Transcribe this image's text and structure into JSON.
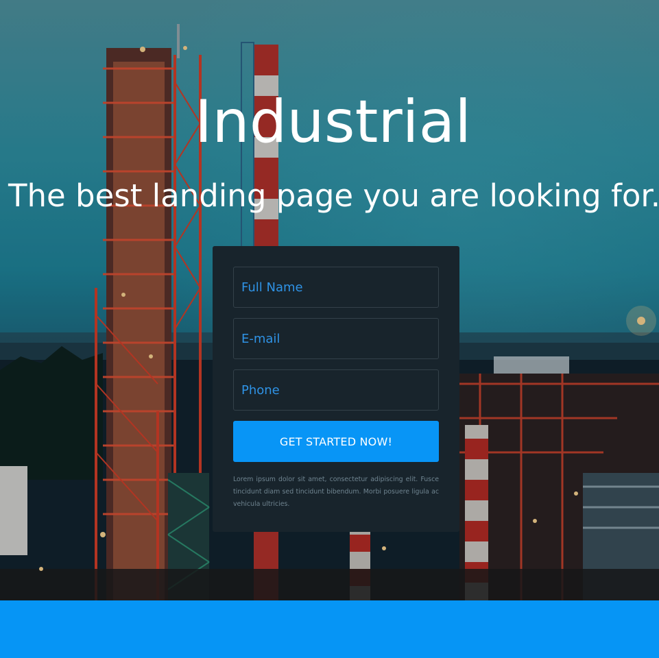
{
  "hero": {
    "title": "Industrial",
    "subtitle": "The best landing page you are looking for."
  },
  "form": {
    "full_name_placeholder": "Full Name",
    "email_placeholder": "E-mail",
    "phone_placeholder": "Phone",
    "submit_label": "GET STARTED NOW!",
    "disclaimer": "Lorem ipsum dolor sit amet, consectetur adipiscing elit. Fusce tincidunt diam sed tincidunt bibendum. Morbi posuere ligula ac vehicula ultricies."
  },
  "colors": {
    "accent": "#0895f6",
    "card_background": "#18242c",
    "field_text": "#2f93e6"
  }
}
